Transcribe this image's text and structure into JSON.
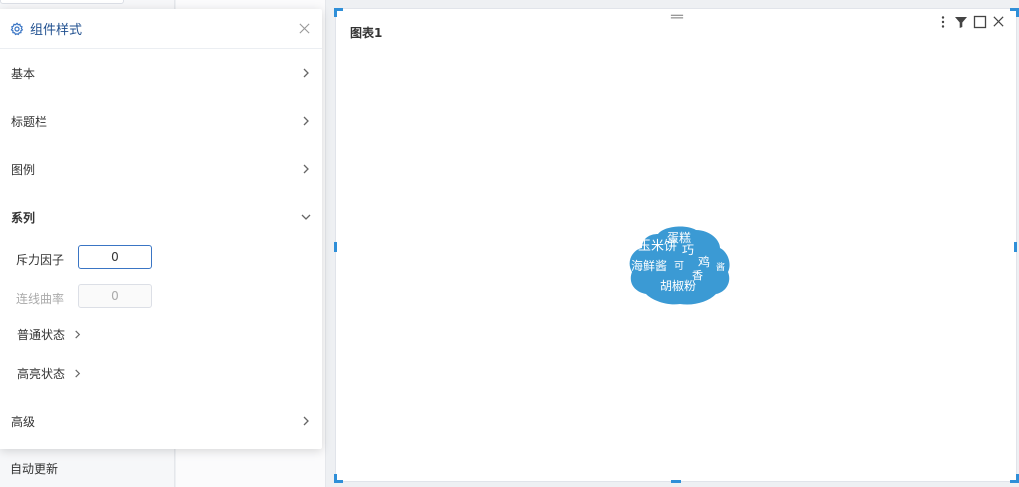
{
  "background": {
    "auto_update_label": "自动更新"
  },
  "panel": {
    "title": "组件样式",
    "sections": {
      "basic": "基本",
      "title_bar": "标题栏",
      "legend": "图例",
      "series": "系列",
      "advanced": "高级"
    },
    "series_fields": {
      "repulsion_label": "斥力因子",
      "repulsion_value": "0",
      "curveness_label": "连线曲率",
      "curveness_value": "0",
      "normal_state": "普通状态",
      "highlight_state": "高亮状态"
    }
  },
  "widget": {
    "title": "图表1",
    "accent_color": "#2f8fd8",
    "cloud_color": "#3b9ad4",
    "words": [
      "蛋糕",
      "玉米饼",
      "巧",
      "海鲜酱",
      "鸡",
      "胡椒粉",
      "香",
      "可",
      "酱"
    ]
  }
}
